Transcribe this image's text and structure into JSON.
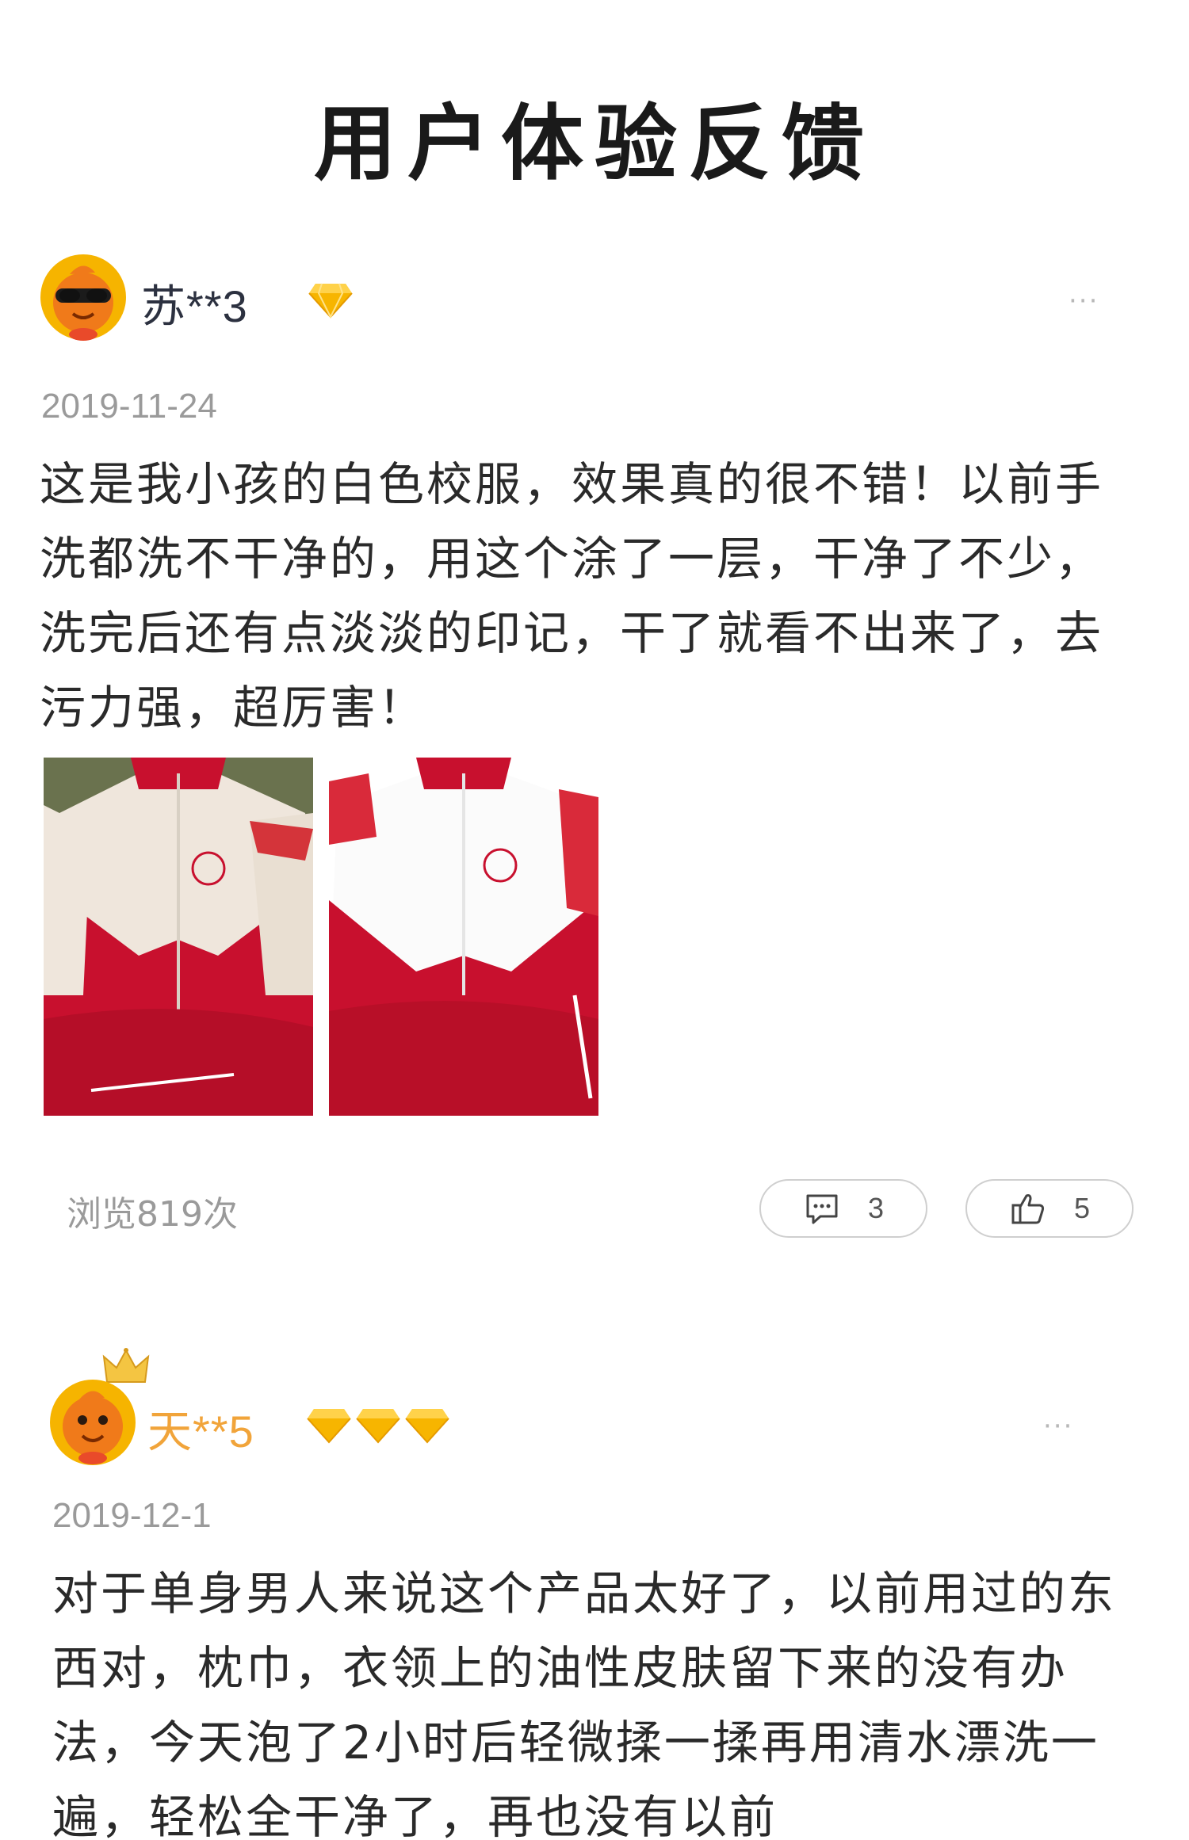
{
  "page": {
    "title": "用户体验反馈"
  },
  "posts": [
    {
      "username": "苏**3",
      "badge_count": 1,
      "more": "···",
      "date": "2019-11-24",
      "text": "这是我小孩的白色校服，效果真的很不错！以前手洗都洗不干净的，用这个涂了一层，干净了不少，洗完后还有点淡淡的印记，干了就看不出来了，去污力强，超厉害！",
      "photos": [
        "jacket-before-photo",
        "jacket-after-photo"
      ],
      "views": "浏览819次",
      "comments": "3",
      "likes": "5"
    },
    {
      "username": "天**5",
      "badge_count": 3,
      "more": "···",
      "date": "2019-12-1",
      "text": "对于单身男人来说这个产品太好了，以前用过的东西对，枕巾，衣领上的油性皮肤留下来的没有办法，今天泡了2小时后轻微揉一揉再用清水漂洗一遍，轻松全干净了，再也没有以前"
    }
  ],
  "colors": {
    "username_1": "#2c3140",
    "username_2": "#f1a43a",
    "badge": "#f7b500",
    "meta": "#9a9a9a",
    "jacket_red": "#c8102e"
  },
  "icons": {
    "comment": "comment-icon",
    "like": "thumbs-up-icon",
    "badge": "diamond-icon",
    "more": "more-dots-icon"
  }
}
